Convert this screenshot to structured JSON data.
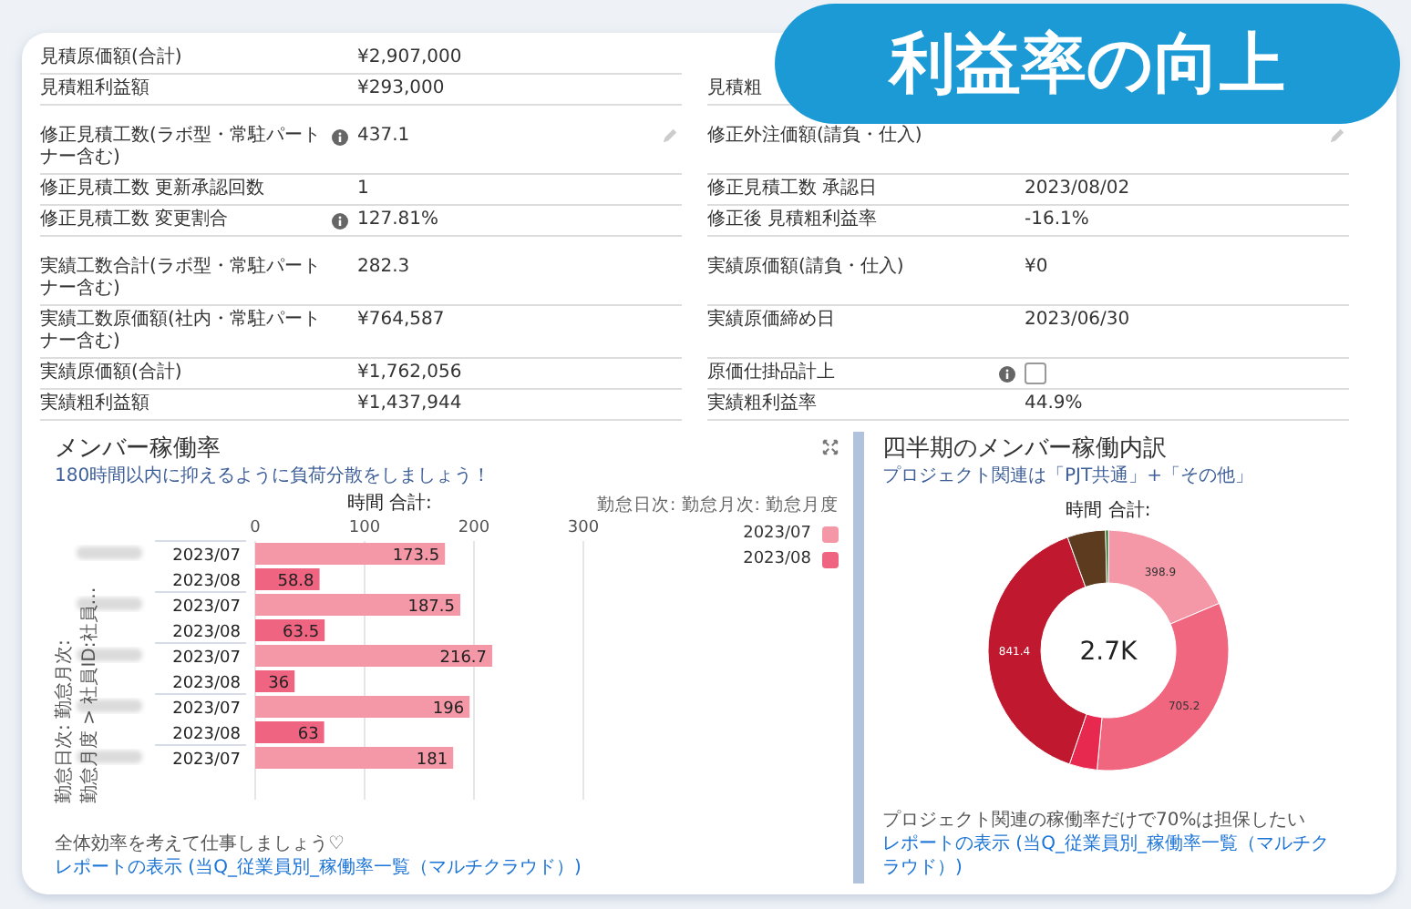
{
  "banner": "利益率の向上",
  "form": {
    "groups": [
      {
        "rows": [
          {
            "left": {
              "label": "見積原価額(合計)",
              "value": "¥2,907,000"
            }
          },
          {
            "left": {
              "label": "見積粗利益額",
              "value": "¥293,000"
            },
            "right": {
              "label": "見積粗"
            }
          }
        ]
      },
      {
        "rows": [
          {
            "left": {
              "label": "修正見積工数(ラボ型・常駐パートナー含む)",
              "info": true,
              "value": "437.1",
              "editable": true
            },
            "right": {
              "label": "修正外注価額(請負・仕入)",
              "editable": true
            }
          },
          {
            "left": {
              "label": "修正見積工数 更新承認回数",
              "value": "1"
            },
            "right": {
              "label": "修正見積工数 承認日",
              "value": "2023/08/02"
            }
          },
          {
            "left": {
              "label": "修正見積工数 変更割合",
              "info": true,
              "value": "127.81%"
            },
            "right": {
              "label": "修正後 見積粗利益率",
              "value": "-16.1%"
            }
          }
        ]
      },
      {
        "rows": [
          {
            "left": {
              "label": "実績工数合計(ラボ型・常駐パートナー含む)",
              "value": "282.3"
            },
            "right": {
              "label": "実績原価額(請負・仕入)",
              "value": "¥0"
            }
          },
          {
            "left": {
              "label": "実績工数原価額(社内・常駐パートナー含む)",
              "value": "¥764,587"
            },
            "right": {
              "label": "実績原価締め日",
              "value": "2023/06/30"
            }
          },
          {
            "left": {
              "label": "実績原価額(合計)",
              "value": "¥1,762,056"
            },
            "right": {
              "label": "原価仕掛品計上",
              "info": true,
              "kind": "checkbox",
              "checked": false
            }
          },
          {
            "left": {
              "label": "実績粗利益額",
              "value": "¥1,437,944"
            },
            "right": {
              "label": "実績粗利益率",
              "value": "44.9%"
            }
          }
        ]
      }
    ]
  },
  "utilization": {
    "title": "メンバー稼働率",
    "subtitle": "180時間以内に抑えるように負荷分散をしましょう！",
    "y_axis_label": [
      "勤怠日次: 勤怠月次:",
      "勤怠月度 > 社員ID:社員…"
    ],
    "members": [
      {
        "periods": [
          "2023/07",
          "2023/08"
        ]
      },
      {
        "periods": [
          "2023/07",
          "2023/08"
        ]
      },
      {
        "periods": [
          "2023/07",
          "2023/08"
        ]
      },
      {
        "periods": [
          "2023/07",
          "2023/08"
        ]
      },
      {
        "periods": [
          "2023/07"
        ]
      }
    ],
    "chart_data": {
      "type": "bar",
      "orientation": "horizontal",
      "xlabel": "時間 合計:",
      "xlim": [
        0,
        300
      ],
      "xticks": [
        0,
        100,
        200,
        300
      ],
      "legend": {
        "title": "勤怠日次: 勤怠月次: 勤怠月度"
      },
      "series": [
        {
          "name": "2023/07",
          "color": "#f497a6",
          "values": [
            173.5,
            187.5,
            216.7,
            196,
            181
          ]
        },
        {
          "name": "2023/08",
          "color": "#ef6480",
          "values": [
            58.8,
            63.5,
            36,
            63,
            null
          ]
        }
      ],
      "value_labels": [
        [
          "173.5",
          "187.5",
          "216.7",
          "196",
          "181"
        ],
        [
          "58.8",
          "63.5",
          "36",
          "63",
          null
        ]
      ]
    },
    "note": "全体効率を考えて仕事しましょう♡",
    "link": "レポートの表示 (当Q_従業員別_稼働率一覧（マルチクラウド）)"
  },
  "breakdown": {
    "title": "四半期のメンバー稼働内訳",
    "subtitle": "プロジェクト関連は「PJT共通」+「その他」",
    "chart_data": {
      "type": "donut",
      "title": "時間 合計:",
      "values": [
        398.9,
        705.2,
        80,
        841.4,
        110,
        8
      ],
      "colors": [
        "#f497a6",
        "#f0667f",
        "#e8294f",
        "#c0182f",
        "#5c3b1e",
        "#1a6b1a"
      ],
      "value_labels": [
        "398.9",
        "705.2",
        null,
        "841.4",
        null,
        null
      ],
      "annotations": [
        {
          "text": "2.7K"
        }
      ]
    },
    "note": "プロジェクト関連の稼働率だけで70%は担保したい",
    "link": "レポートの表示 (当Q_従業員別_稼働率一覧（マルチクラウド）)"
  }
}
